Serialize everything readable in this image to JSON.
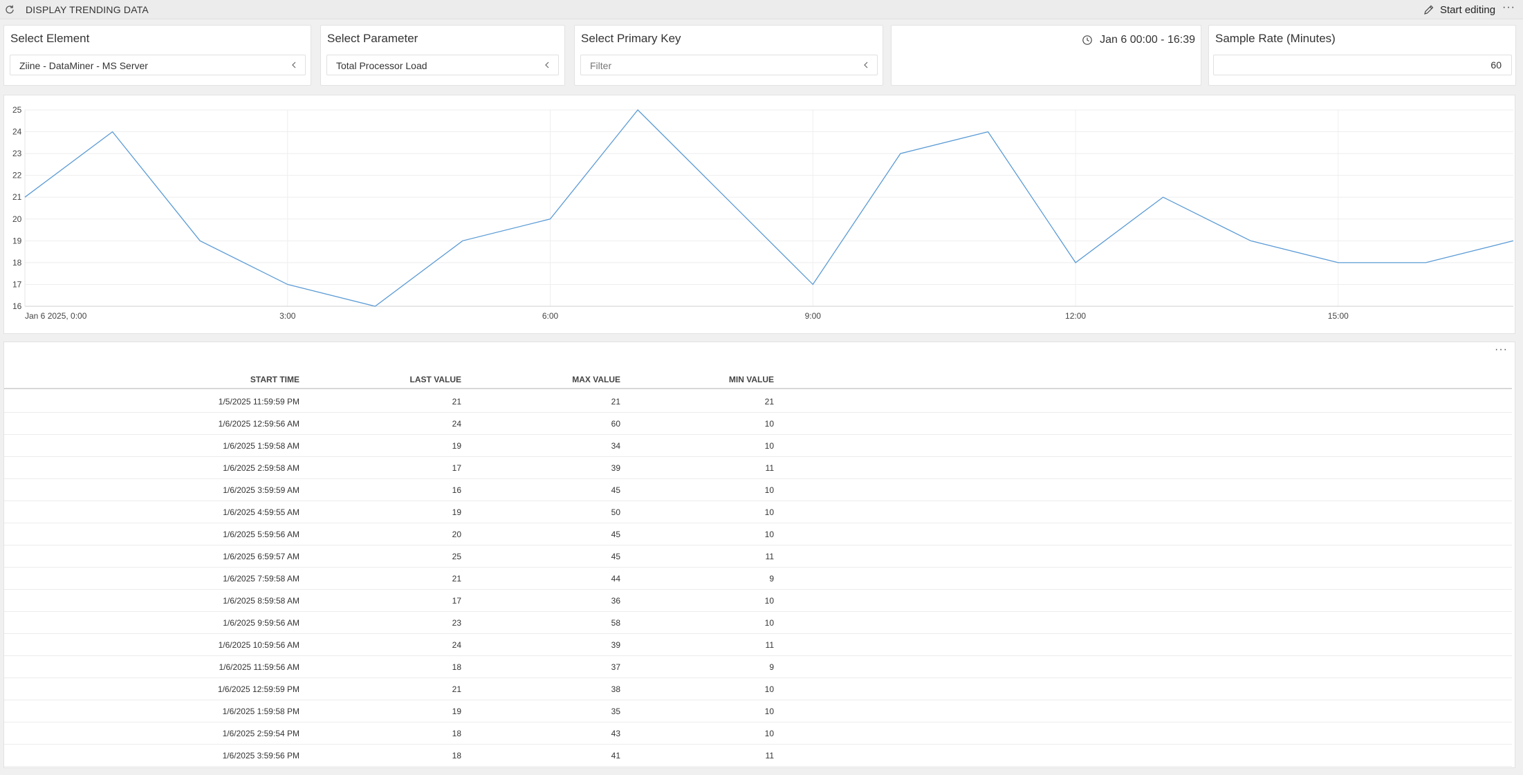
{
  "header": {
    "title": "DISPLAY TRENDING DATA",
    "edit_label": "Start editing",
    "more": "···"
  },
  "filters": {
    "element": {
      "title": "Select Element",
      "value": "Ziine - DataMiner - MS Server"
    },
    "parameter": {
      "title": "Select Parameter",
      "value": "Total Processor Load"
    },
    "primary_key": {
      "title": "Select Primary Key",
      "placeholder": "Filter"
    },
    "time_range": {
      "value": "Jan 6 00:00 - 16:39"
    },
    "sample_rate": {
      "title": "Sample Rate (Minutes)",
      "value": "60"
    }
  },
  "chart_data": {
    "type": "line",
    "title": "",
    "xlabel": "",
    "ylabel": "",
    "x_ticks": [
      "Jan 6 2025, 0:00",
      "3:00",
      "6:00",
      "9:00",
      "12:00",
      "15:00"
    ],
    "y_ticks": [
      16,
      17,
      18,
      19,
      20,
      21,
      22,
      23,
      24,
      25
    ],
    "xlim": [
      0,
      17
    ],
    "ylim": [
      16,
      25
    ],
    "grid": true,
    "legend": "none",
    "series": [
      {
        "color": "#5b9bd5",
        "x": [
          0,
          1,
          2,
          3,
          4,
          5,
          6,
          7,
          8,
          9,
          10,
          11,
          12,
          13,
          14,
          15,
          16,
          17
        ],
        "values": [
          21,
          24,
          19,
          17,
          16,
          19,
          20,
          25,
          21,
          17,
          23,
          24,
          18,
          21,
          19,
          18,
          18,
          19
        ]
      }
    ]
  },
  "table": {
    "more": "···",
    "columns": [
      "START TIME",
      "LAST VALUE",
      "MAX VALUE",
      "MIN VALUE"
    ],
    "rows": [
      [
        "1/5/2025 11:59:59 PM",
        "21",
        "21",
        "21"
      ],
      [
        "1/6/2025 12:59:56 AM",
        "24",
        "60",
        "10"
      ],
      [
        "1/6/2025 1:59:58 AM",
        "19",
        "34",
        "10"
      ],
      [
        "1/6/2025 2:59:58 AM",
        "17",
        "39",
        "11"
      ],
      [
        "1/6/2025 3:59:59 AM",
        "16",
        "45",
        "10"
      ],
      [
        "1/6/2025 4:59:55 AM",
        "19",
        "50",
        "10"
      ],
      [
        "1/6/2025 5:59:56 AM",
        "20",
        "45",
        "10"
      ],
      [
        "1/6/2025 6:59:57 AM",
        "25",
        "45",
        "11"
      ],
      [
        "1/6/2025 7:59:58 AM",
        "21",
        "44",
        "9"
      ],
      [
        "1/6/2025 8:59:58 AM",
        "17",
        "36",
        "10"
      ],
      [
        "1/6/2025 9:59:56 AM",
        "23",
        "58",
        "10"
      ],
      [
        "1/6/2025 10:59:56 AM",
        "24",
        "39",
        "11"
      ],
      [
        "1/6/2025 11:59:56 AM",
        "18",
        "37",
        "9"
      ],
      [
        "1/6/2025 12:59:59 PM",
        "21",
        "38",
        "10"
      ],
      [
        "1/6/2025 1:59:58 PM",
        "19",
        "35",
        "10"
      ],
      [
        "1/6/2025 2:59:54 PM",
        "18",
        "43",
        "10"
      ],
      [
        "1/6/2025 3:59:56 PM",
        "18",
        "41",
        "11"
      ]
    ]
  }
}
